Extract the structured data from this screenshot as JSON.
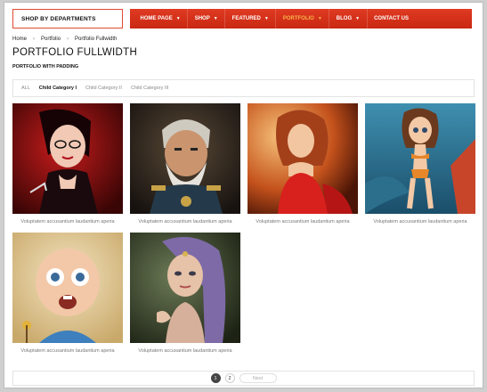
{
  "header": {
    "departments_label": "SHOP BY DEPARTMENTS",
    "nav": [
      {
        "label": "HOME PAGE",
        "active": false
      },
      {
        "label": "SHOP",
        "active": false
      },
      {
        "label": "FEATURED",
        "active": false
      },
      {
        "label": "PORTFOLIO",
        "active": true
      },
      {
        "label": "BLOG",
        "active": false
      },
      {
        "label": "CONTACT US",
        "active": false
      }
    ]
  },
  "breadcrumb": [
    "Home",
    "Portfolio",
    "Portfolio Fullwidth"
  ],
  "page": {
    "title": "PORTFOLIO FULLWIDTH",
    "subtitle": "PORTFOLIO WITH PADDING"
  },
  "filters": [
    {
      "label": "ALL",
      "active": false
    },
    {
      "label": "Child Category I",
      "active": true
    },
    {
      "label": "Child Category II",
      "active": false
    },
    {
      "label": "Child Category III",
      "active": false
    }
  ],
  "items": [
    {
      "caption": "Voluptatem accusantium laudantium aperia"
    },
    {
      "caption": "Voluptatem accusantium laudantium aperia"
    },
    {
      "caption": "Voluptatem accusantium laudantium aperia"
    },
    {
      "caption": "Voluptatem accusantium laudantium aperia"
    },
    {
      "caption": "Voluptatem accusantium laudantium aperia"
    },
    {
      "caption": "Voluptatem accusantium laudantium aperia"
    }
  ],
  "pagination": {
    "pages": [
      "1",
      "2"
    ],
    "current": "1",
    "next_label": "Next"
  },
  "colors": {
    "nav_red": "#d3301a",
    "active_nav": "#f7b34a",
    "dept_border": "#e04a2f"
  }
}
